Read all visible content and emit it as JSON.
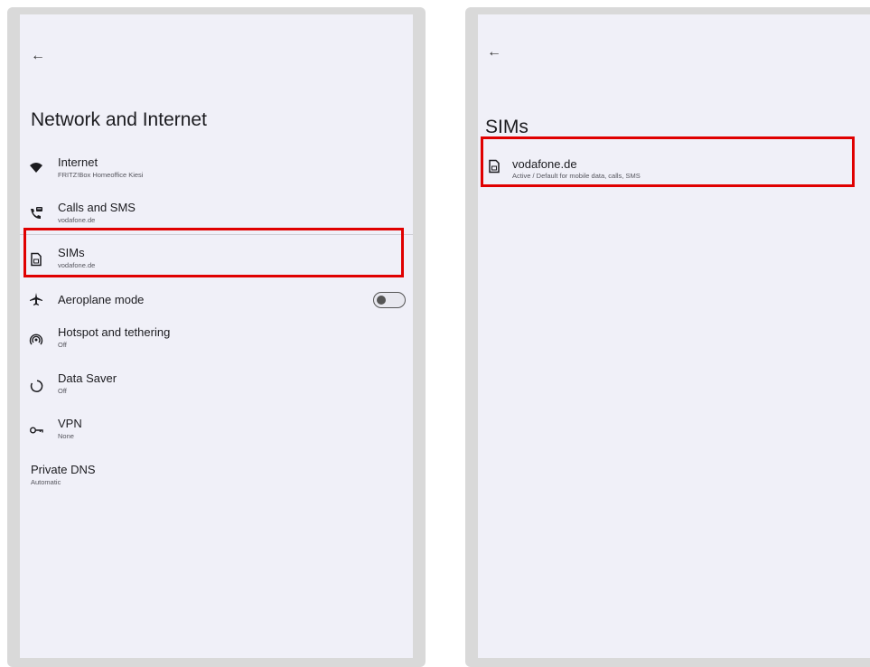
{
  "left": {
    "back_glyph": "←",
    "title": "Network and Internet",
    "items": [
      {
        "label": "Internet",
        "sub": "FRITZ!Box Homeoffice Kiesi",
        "icon": "wifi-icon"
      },
      {
        "label": "Calls and SMS",
        "sub": "vodafone.de",
        "icon": "calls-sms-icon"
      },
      {
        "label": "SIMs",
        "sub": "vodafone.de",
        "icon": "sim-card-icon"
      },
      {
        "label": "Aeroplane mode",
        "sub": "",
        "icon": "airplane-icon",
        "toggle_on": false
      },
      {
        "label": "Hotspot and tethering",
        "sub": "Off",
        "icon": "hotspot-icon"
      },
      {
        "label": "Data Saver",
        "sub": "Off",
        "icon": "data-saver-icon"
      },
      {
        "label": "VPN",
        "sub": "None",
        "icon": "vpn-key-icon"
      },
      {
        "label": "Private DNS",
        "sub": "Automatic",
        "icon": ""
      }
    ]
  },
  "right": {
    "back_glyph": "←",
    "title": "SIMs",
    "items": [
      {
        "label": "vodafone.de",
        "sub": "Active / Default for mobile data, calls, SMS",
        "icon": "sim-card-icon"
      }
    ]
  },
  "colors": {
    "highlight": "#e00000",
    "screen_bg": "#f0f0f8",
    "frame": "#d9d9d9"
  }
}
